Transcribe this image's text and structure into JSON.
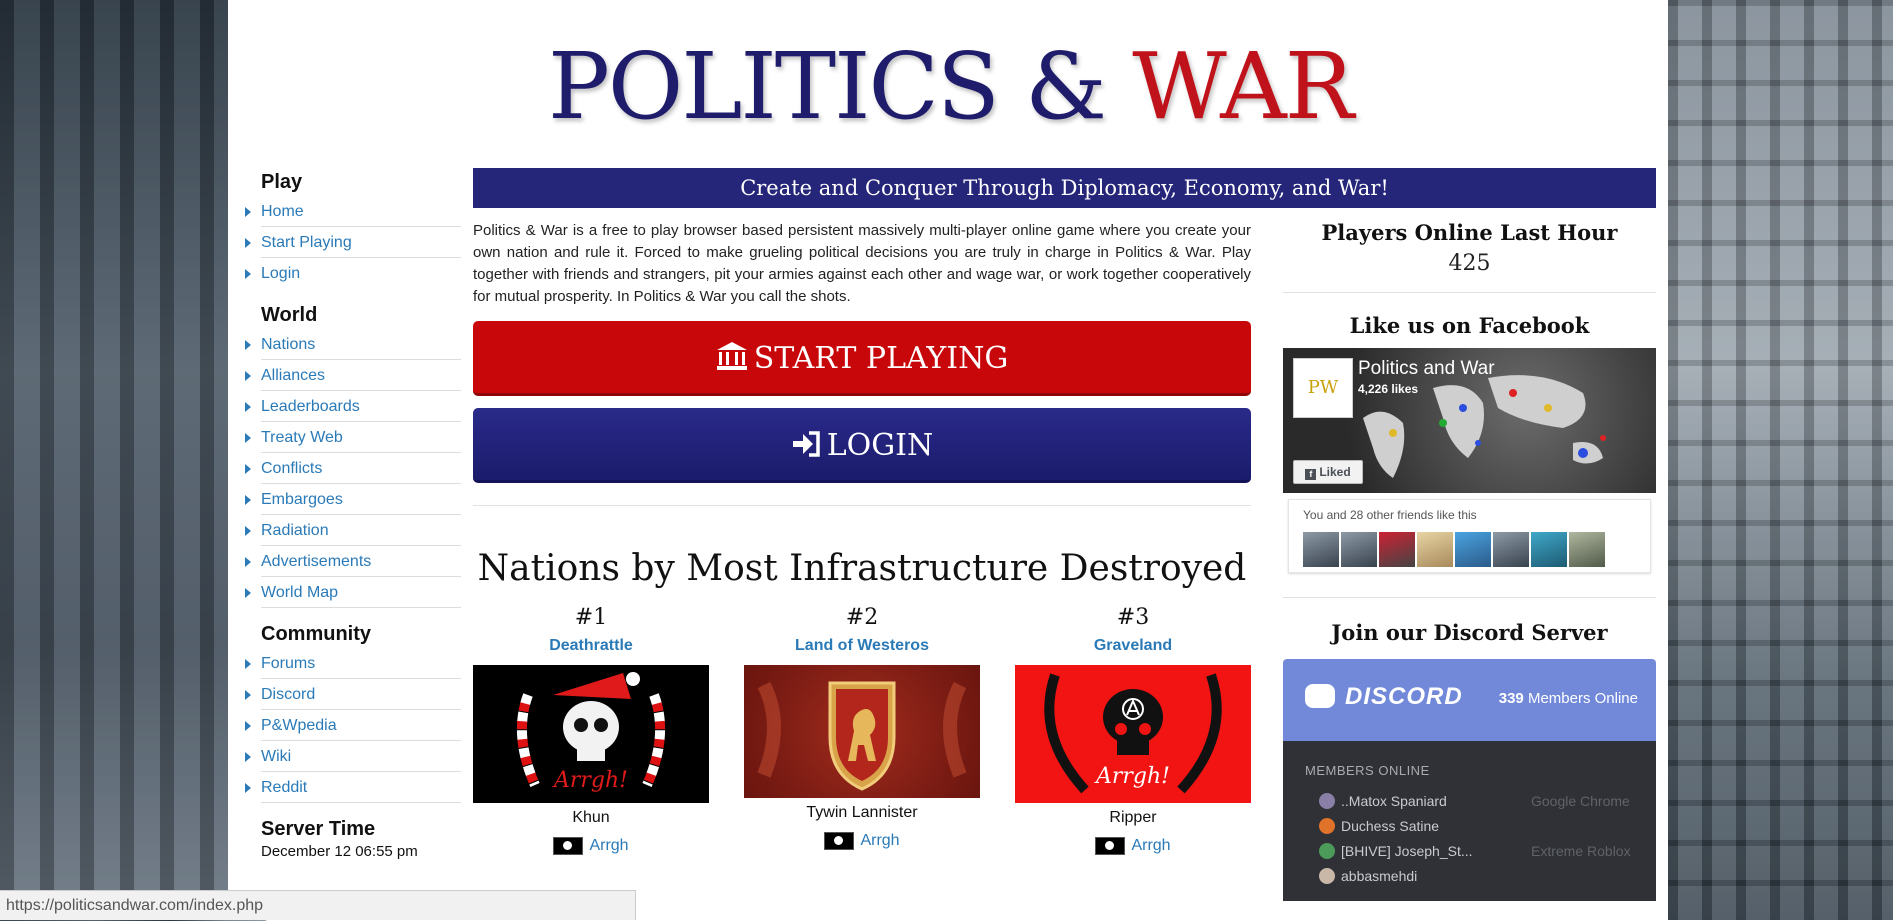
{
  "logo": {
    "part1": "POLITICS ",
    "amp": "& ",
    "part2": "WAR"
  },
  "sidebar": {
    "play": {
      "title": "Play",
      "items": [
        "Home",
        "Start Playing",
        "Login"
      ]
    },
    "world": {
      "title": "World",
      "items": [
        "Nations",
        "Alliances",
        "Leaderboards",
        "Treaty Web",
        "Conflicts",
        "Embargoes",
        "Radiation",
        "Advertisements",
        "World Map"
      ]
    },
    "community": {
      "title": "Community",
      "items": [
        "Forums",
        "Discord",
        "P&Wpedia",
        "Wiki",
        "Reddit"
      ]
    },
    "server": {
      "title": "Server Time",
      "time": "December 12 06:55 pm"
    }
  },
  "main": {
    "banner": "Create and Conquer Through Diplomacy, Economy, and War!",
    "intro": "Politics & War is a free to play browser based persistent massively multi-player online game where you create your own nation and rule it. Forced to make grueling political decisions you are truly in charge in Politics & War. Play together with friends and strangers, pit your armies against each other and wage war, or work together cooperatively for mutual prosperity. In Politics & War you call the shots.",
    "start_label": "START PLAYING",
    "login_label": "LOGIN",
    "section_title": "Nations by Most Infrastructure Destroyed",
    "ranks": [
      {
        "num": "#1",
        "nation": "Deathrattle",
        "flag_text": "Arrgh!",
        "leader": "Khun",
        "alliance": "Arrgh"
      },
      {
        "num": "#2",
        "nation": "Land of Westeros",
        "flag_text": "",
        "leader": "Tywin Lannister",
        "alliance": "Arrgh"
      },
      {
        "num": "#3",
        "nation": "Graveland",
        "flag_text": "Arrgh!",
        "leader": "Ripper",
        "alliance": "Arrgh"
      }
    ]
  },
  "right": {
    "online_title": "Players Online Last Hour",
    "online_count": "425",
    "fb_title": "Like us on Facebook",
    "fb_page": "Politics and War",
    "fb_likes": "4,226 likes",
    "fb_logo": "PW",
    "fb_liked": "Liked",
    "fb_friends": "You and 28 other friends like this",
    "discord_title": "Join our Discord Server",
    "discord_logo": "DISCORD",
    "discord_count": "339",
    "discord_count_suffix": " Members Online",
    "discord_sub": "MEMBERS ONLINE",
    "members": [
      {
        "name": "..Matox Spaniard",
        "game": "Google Chrome",
        "color": "#8a7fa6"
      },
      {
        "name": "Duchess Satine",
        "game": "",
        "color": "#e0722a"
      },
      {
        "name": "[BHIVE] Joseph_St...",
        "game": "Extreme Roblox",
        "color": "#4c9b5a"
      },
      {
        "name": "abbasmehdi",
        "game": "",
        "color": "#c9b8a8"
      }
    ]
  },
  "statusbar": "https://politicsandwar.com/index.php",
  "colors": {
    "navy": "#25257a",
    "red": "#c8070a",
    "link": "#2a7ab8",
    "discord": "#7289da"
  }
}
